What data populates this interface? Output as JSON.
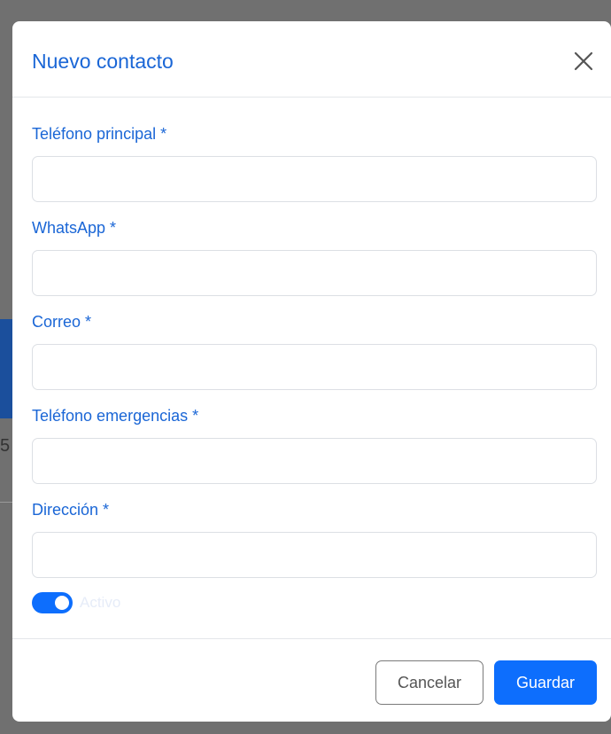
{
  "modal": {
    "title": "Nuevo contacto",
    "close_icon": "close-icon"
  },
  "form": {
    "fields": [
      {
        "label": "Teléfono principal *",
        "value": "",
        "placeholder": ""
      },
      {
        "label": "WhatsApp *",
        "value": "",
        "placeholder": ""
      },
      {
        "label": "Correo *",
        "value": "",
        "placeholder": ""
      },
      {
        "label": "Teléfono emergencias *",
        "value": "",
        "placeholder": ""
      },
      {
        "label": "Dirección *",
        "value": "",
        "placeholder": ""
      }
    ],
    "toggle": {
      "label": "Activo",
      "checked": true
    }
  },
  "footer": {
    "cancel_label": "Cancelar",
    "save_label": "Guardar"
  },
  "colors": {
    "accent": "#0d6efd",
    "title": "#1a66d6"
  }
}
